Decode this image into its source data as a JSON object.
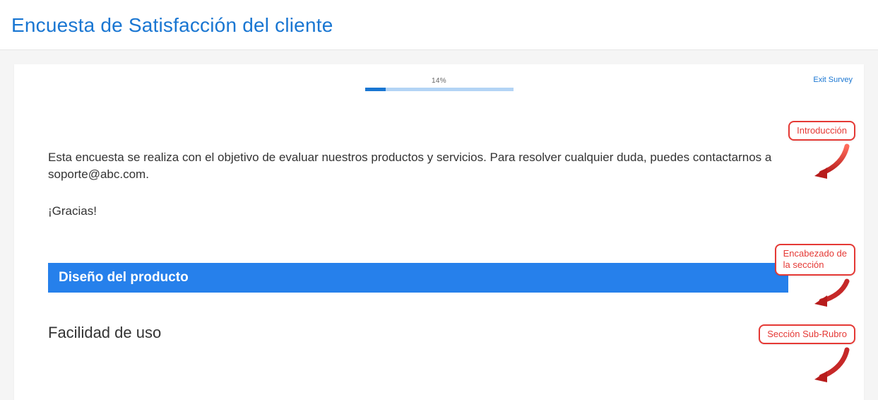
{
  "page": {
    "title": "Encuesta de Satisfacción del cliente"
  },
  "survey": {
    "progress": {
      "percent_label": "14%",
      "percent_value": 14
    },
    "exit_label": "Exit Survey",
    "intro": {
      "paragraph": "Esta encuesta se realiza con el objetivo de evaluar nuestros productos y servicios. Para resolver cualquier duda, puedes contactarnos a soporte@abc.com.",
      "thanks": "¡Gracias!"
    },
    "section_header": "Diseño del producto",
    "sub_heading": "Facilidad de uso"
  },
  "annotations": {
    "intro_label": "Introducción",
    "section_header_label": "Encabezado de\nla sección",
    "sub_section_label": "Sección Sub-Rubro"
  },
  "colors": {
    "primary": "#1976d2",
    "section_bg": "#2680eb",
    "annotation": "#e53935"
  }
}
